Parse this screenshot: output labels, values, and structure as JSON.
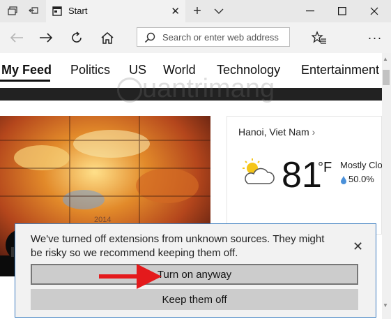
{
  "tab": {
    "title": "Start"
  },
  "navbar": {
    "address_placeholder": "Search or enter web address"
  },
  "feed": {
    "tabs": [
      "My Feed",
      "Politics",
      "US",
      "World",
      "Technology",
      "Entertainment"
    ]
  },
  "hero": {
    "image_year": "2014"
  },
  "weather": {
    "city": "Hanoi, Viet Nam",
    "chevron": "›",
    "temperature": "81",
    "unit": "°F",
    "condition": "Mostly Clo",
    "precip": "50.0%"
  },
  "dialog": {
    "message": "We've turned off extensions from unknown sources. They might be risky so we recommend keeping them off.",
    "primary_label": "Turn on anyway",
    "secondary_label": "Keep them off"
  },
  "colors": {
    "accent": "#3c7dbf",
    "arrow": "#e41a1c"
  },
  "watermark": "uantrimang"
}
